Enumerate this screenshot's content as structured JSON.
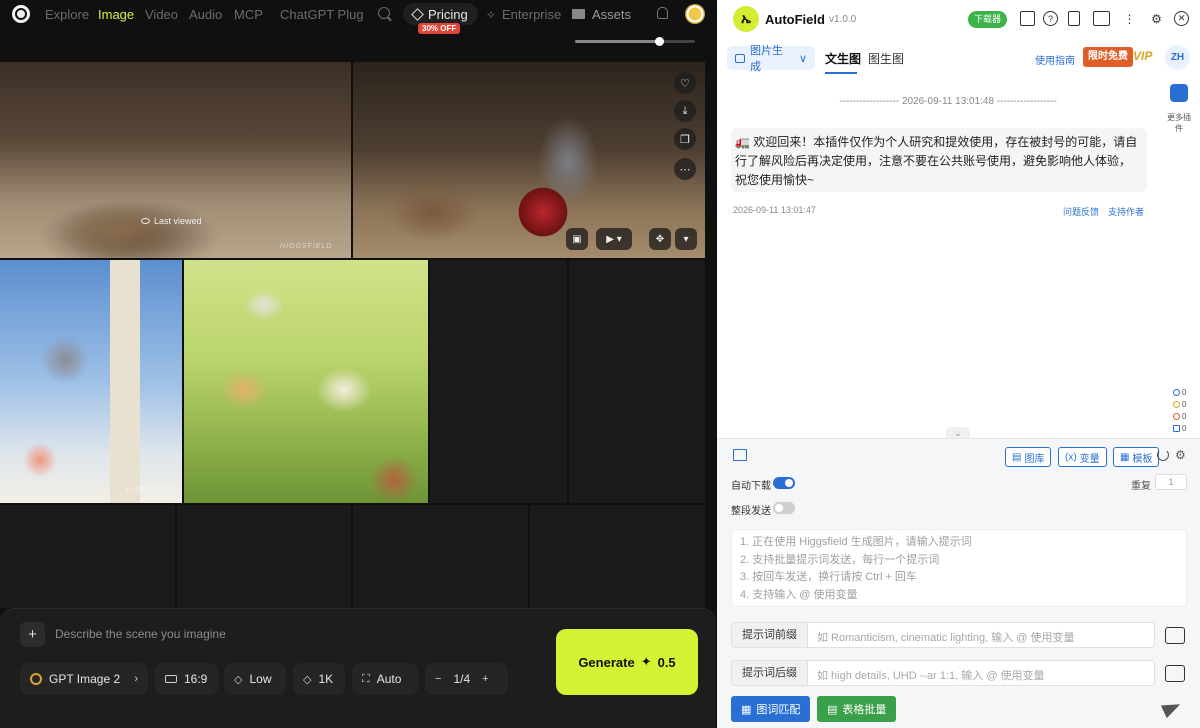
{
  "nav": {
    "items": [
      "Explore",
      "Image",
      "Video",
      "Audio",
      "MCP",
      "ChatGPT Plug"
    ],
    "pricing": "Pricing",
    "discount": "30% OFF",
    "enterprise": "Enterprise",
    "assets": "Assets"
  },
  "zoom_level": 0.7,
  "gallery": {
    "last_viewed": "Last viewed",
    "watermark": "HIGGSFIELD"
  },
  "composer": {
    "placeholder": "Describe the scene you imagine",
    "model": "GPT Image 2",
    "ratio": "16:9",
    "quality": "Low",
    "resolution": "1K",
    "mode": "Auto",
    "batch": "1/4",
    "generate": "Generate",
    "cost": "0.5"
  },
  "ext": {
    "title": "AutoField",
    "version": "v1.0.0",
    "download_badge": "下载器",
    "dropdown": "图片生成",
    "tabs": [
      "文生图",
      "图生图"
    ],
    "guide": "使用指南",
    "free": "限时免费",
    "vip": "VIP",
    "lang": "ZH",
    "plugin_label": "更多插件",
    "stats": [
      "0",
      "0",
      "0",
      "0"
    ],
    "chat_time": "------------------ 2026-09-11 13:01:48 ------------------",
    "message": "🚛 欢迎回来！本插件仅作为个人研究和提效使用，存在被封号的可能，请自行了解风险后再决定使用，注意不要在公共账号使用，避免影响他人体验，祝您使用愉快~",
    "msg_time": "2026-09-11 13:01:47",
    "feedback": "问题反馈",
    "support": "支持作者",
    "gallery_btn": "图库",
    "var_btn": "变量",
    "template_btn": "模板",
    "auto_download": "自动下载",
    "segment_send": "整段发送",
    "repeat": "重复",
    "repeat_value": "1",
    "prompt_lines": [
      "1. 正在使用 Higgsfield 生成图片，请输入提示词",
      "2. 支持批量提示词发送，每行一个提示词",
      "3. 按回车发送，换行请按 Ctrl + 回车",
      "4. 支持输入 @ 使用变量"
    ],
    "prefix_label": "提示词前缀",
    "prefix_ph": "如 Romanticism, cinematic lighting, 输入 @ 使用变量",
    "suffix_label": "提示词后缀",
    "suffix_ph": "如 high details, UHD --ar 1:1, 输入 @ 使用变量",
    "match_btn": "图词匹配",
    "table_btn": "表格批量"
  }
}
